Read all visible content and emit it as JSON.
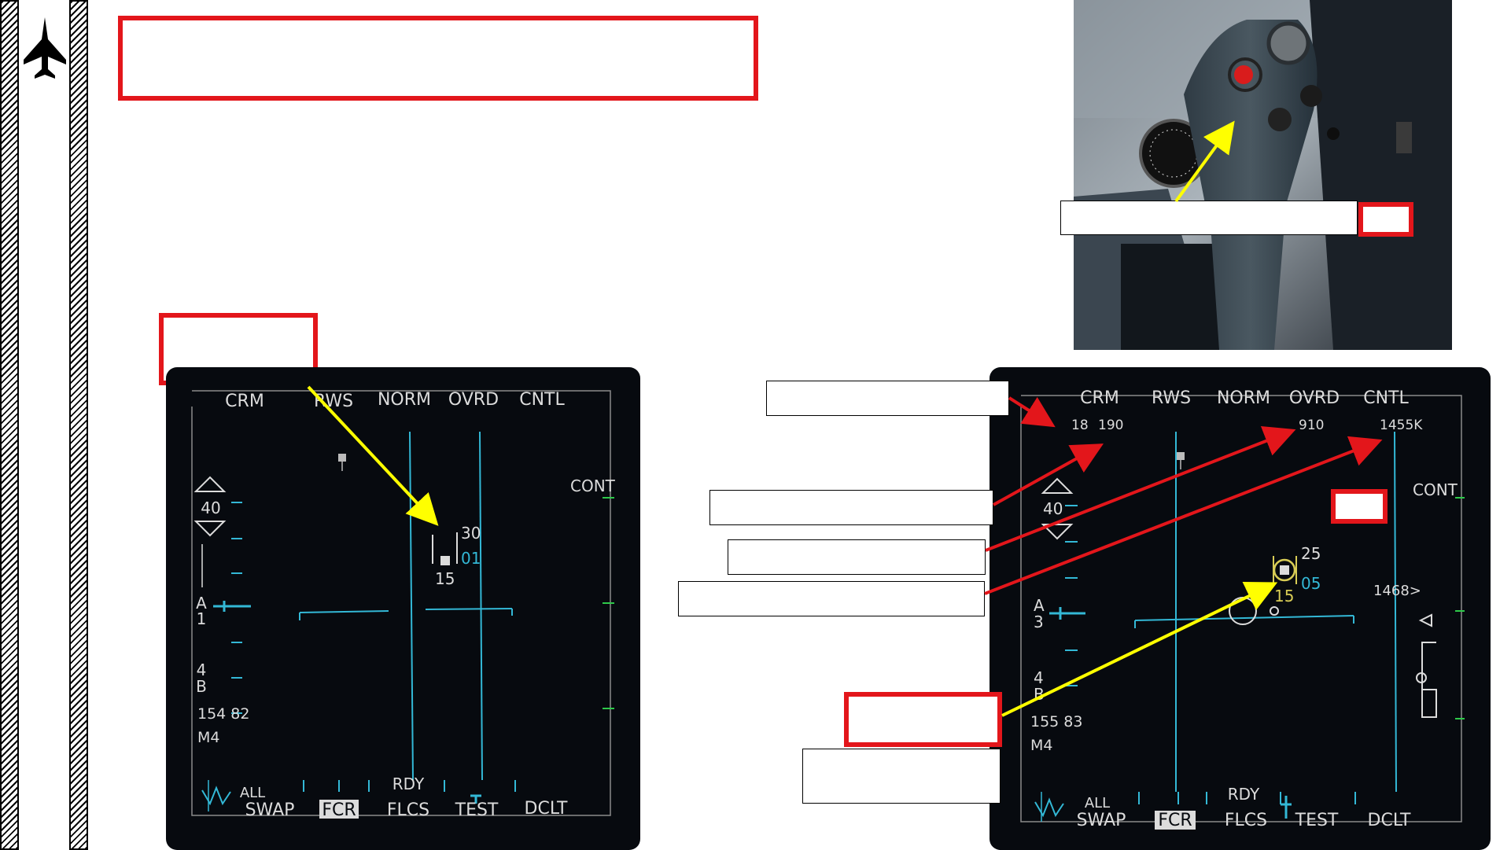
{
  "colors": {
    "red_frame": "#e3161b",
    "arrow_red": "#e3161b",
    "arrow_yellow": "#ffff00",
    "mfd_text": "#dcdcdc",
    "mfd_cyan": "#33b8d6",
    "mfd_green": "#2ec94a",
    "mfd_yellow": "#d8cc55"
  },
  "icons": {
    "sidebar_logo": "fighter-jet-icon"
  },
  "mfd_left": {
    "top_labels": [
      "CRM",
      "RWS",
      "NORM",
      "OVRD",
      "CNTL"
    ],
    "cont": "CONT",
    "range": "40",
    "azimuth": [
      "A",
      "1"
    ],
    "bars": [
      "4",
      "B"
    ],
    "readout": "154 82",
    "mode": "M4",
    "target_upper": "30",
    "target_cyan": "01",
    "target_lower": "15",
    "bottom_upper": [
      "ALL",
      "RDY"
    ],
    "bottom_labels": [
      "SWAP",
      "FCR",
      "FLCS",
      "TEST",
      "DCLT"
    ]
  },
  "mfd_right": {
    "top_labels": [
      "CRM",
      "RWS",
      "NORM",
      "OVRD",
      "CNTL"
    ],
    "sub_labels": [
      "18",
      "190",
      "910",
      "1455K"
    ],
    "cont": "CONT",
    "range": "40",
    "azimuth": [
      "A",
      "3"
    ],
    "bars": [
      "4",
      "B"
    ],
    "readout": "155 83",
    "mode": "M4",
    "target_upper": "25",
    "target_cyan": "05",
    "target_lower": "15",
    "closure": "1468>",
    "bottom_upper": [
      "ALL",
      "RDY"
    ],
    "bottom_labels": [
      "SWAP",
      "FCR",
      "FLCS",
      "TEST",
      "DCLT"
    ]
  }
}
